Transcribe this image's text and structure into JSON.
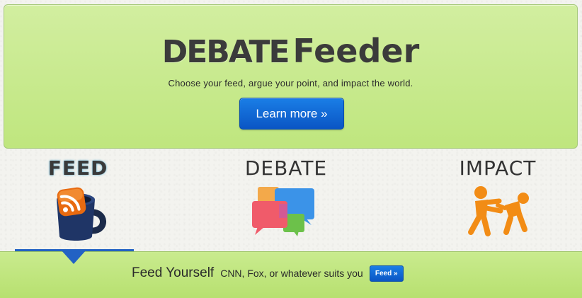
{
  "hero": {
    "logo_debate": "DEBATE",
    "logo_feeder": "Feeder",
    "tagline": "Choose your feed, argue your point, and impact the world.",
    "learn_more_label": "Learn more »"
  },
  "columns": {
    "feed": {
      "title": "FEED",
      "icon": "rss-mug-icon"
    },
    "debate": {
      "title": "DEBATE",
      "icon": "speech-bubbles-icon"
    },
    "impact": {
      "title": "IMPACT",
      "icon": "figures-pushing-icon"
    }
  },
  "bottom_bar": {
    "title": "Feed Yourself",
    "description": "CNN, Fox, or whatever suits you",
    "button_label": "Feed »"
  },
  "colors": {
    "hero_green": "#c6e98a",
    "button_blue": "#0a62d6",
    "accent_orange": "#f08a12",
    "pointer_blue": "#2262c4"
  }
}
